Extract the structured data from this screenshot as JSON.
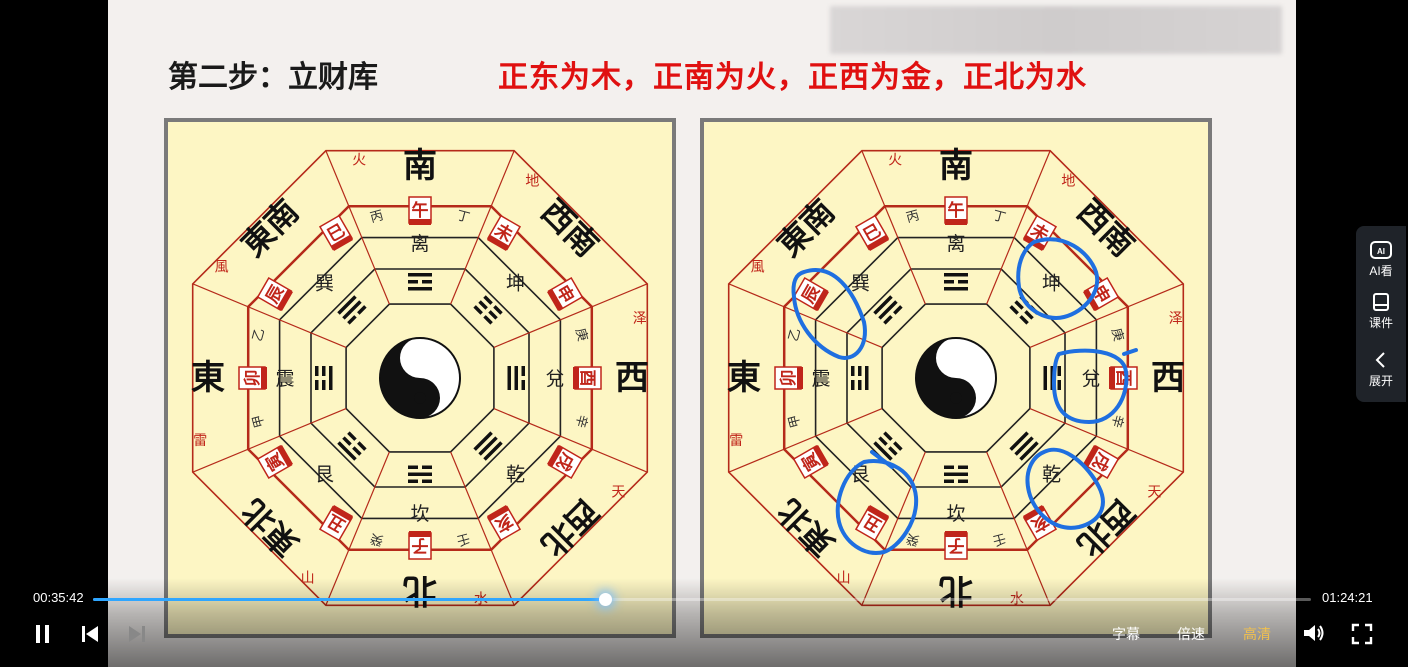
{
  "video": {
    "slide_step_title": "第二步：立财库",
    "slide_elements_title": "正东为木，正南为火，正西为金，正北为水",
    "diagram": {
      "directions": {
        "south": "南",
        "north": "北",
        "east": "東",
        "west": "西",
        "southeast": "東南",
        "southwest": "西南",
        "northeast": "東北",
        "northwest": "西北"
      },
      "outer_labels": {
        "south": "火",
        "southwest": "地",
        "west": "泽",
        "northwest": "天",
        "north": "水",
        "northeast": "山",
        "east": "雷",
        "southeast": "風"
      },
      "trigrams": {
        "south": "离",
        "southwest": "坤",
        "west": "兌",
        "northwest": "乾",
        "north": "坎",
        "northeast": "艮",
        "east": "震",
        "southeast": "巽"
      },
      "stems": {
        "south_a": "丙",
        "south_b": "丁",
        "west_a": "庚",
        "west_b": "辛",
        "north_a": "壬",
        "north_b": "癸",
        "east_a": "甲",
        "east_b": "乙"
      },
      "branches": {
        "wu": "午",
        "wei": "未",
        "shen": "申",
        "you": "酉",
        "xu": "戌",
        "hai": "亥",
        "zi": "子",
        "chou": "丑",
        "yin": "寅",
        "mao": "卯",
        "chen": "辰",
        "si": "巳"
      }
    }
  },
  "player": {
    "current_time": "00:35:42",
    "total_time": "01:24:21",
    "progress": 0.42,
    "subtitle_label": "字幕",
    "speed_label": "倍速",
    "quality_label": "高清"
  },
  "side_panel": {
    "ai_label": "AI看",
    "courseware_label": "课件",
    "expand_label": "展开"
  },
  "colors": {
    "accent": "#2fa6ff",
    "quality_active": "#f2c14e",
    "annotation_blue": "#1f6fe0"
  }
}
